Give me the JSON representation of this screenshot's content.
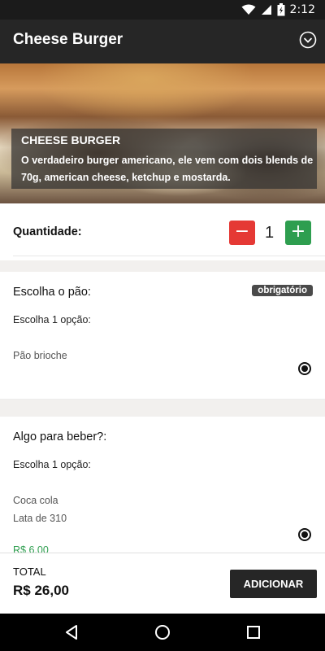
{
  "status_bar": {
    "time": "2:12",
    "icons": [
      "wifi-icon",
      "cell-signal-icon",
      "battery-icon"
    ]
  },
  "app_bar": {
    "title": "Cheese Burger",
    "menu_icon": "chevron-down-circle-icon"
  },
  "product": {
    "title": "CHEESE BURGER",
    "description": "O verdadeiro burger americano, ele vem com dois blends de 70g, american cheese, ketchup e mostarda."
  },
  "quantity": {
    "label": "Quantidade:",
    "value": "1",
    "minus": "−",
    "plus": "+"
  },
  "sections": [
    {
      "title": "Escolha o pão:",
      "badge": "obrigatório",
      "subtitle": "Escolha 1 opção:",
      "options": [
        {
          "name": "Pão brioche",
          "selected": true
        }
      ]
    },
    {
      "title": "Algo para beber?:",
      "subtitle": "Escolha 1 opção:",
      "options": [
        {
          "name": "Coca cola",
          "detail": "Lata de 310",
          "price": "R$ 6,00",
          "selected": true
        }
      ]
    }
  ],
  "footer": {
    "total_label": "TOTAL",
    "total_value": "R$ 26,00",
    "add_label": "ADICIONAR"
  },
  "colors": {
    "app_bar": "#262626",
    "minus": "#e53935",
    "plus": "#2e9e4f",
    "price": "#2e9e4f",
    "badge": "#4a4a4a"
  }
}
